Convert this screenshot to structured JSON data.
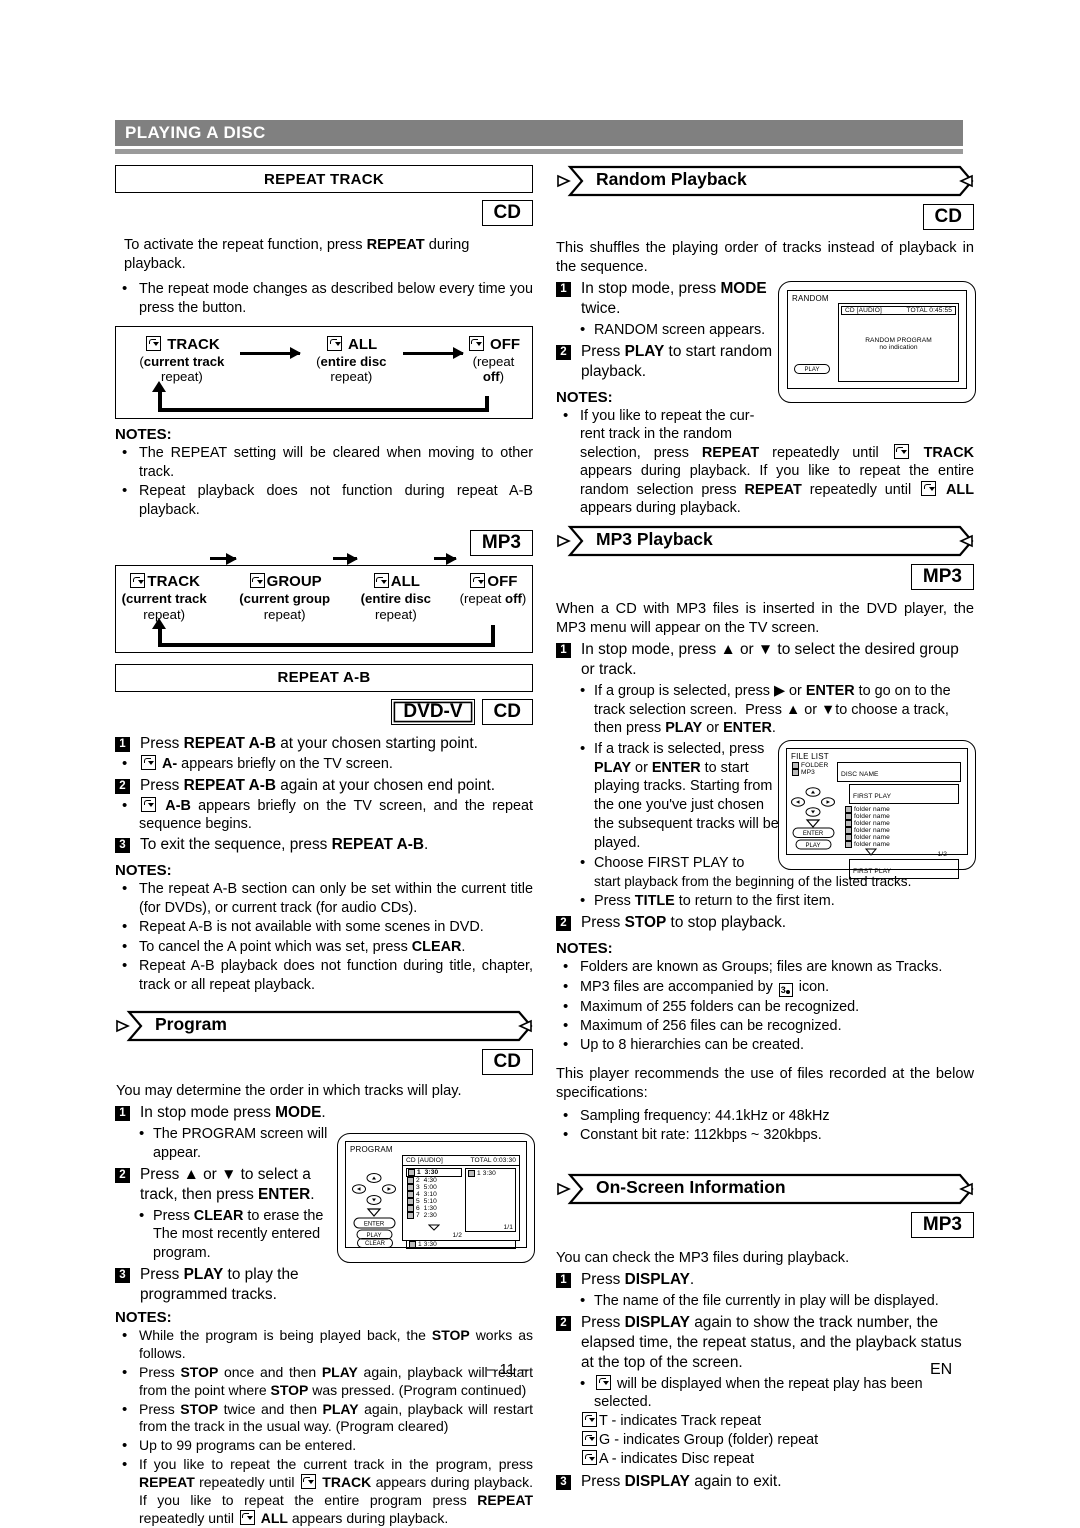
{
  "chapter": {
    "title": "PLAYING A DISC"
  },
  "footer": {
    "page": "– 11 –",
    "lang": "EN"
  },
  "left": {
    "repeat_track": {
      "box_title": "REPEAT TRACK",
      "badges": [
        "CD"
      ],
      "intro": "To activate the repeat function, press REPEAT during playback.",
      "intro_bold": "REPEAT",
      "bullets": [
        "The repeat mode changes as described below every time you press the button."
      ],
      "cd_flow": {
        "nodes": [
          {
            "title": "TRACK",
            "sub": "(current track repeat)",
            "sub_bold": "current track"
          },
          {
            "title": "ALL",
            "sub": "(entire disc repeat)",
            "sub_bold": "entire disc"
          },
          {
            "title": "OFF",
            "sub": "(repeat off)",
            "sub_bold": "off"
          }
        ]
      },
      "notes_label": "NOTES:",
      "notes": [
        "The REPEAT setting will be cleared when moving to other track.",
        "Repeat playback does not function during repeat A-B playback."
      ],
      "mp3_badge": "MP3",
      "mp3_flow": {
        "nodes": [
          {
            "title": "TRACK",
            "sub1": "(current track",
            "sub2": "repeat)"
          },
          {
            "title": "GROUP",
            "sub1": "(current group",
            "sub2": "repeat)"
          },
          {
            "title": "ALL",
            "sub1": "(entire disc",
            "sub2": "repeat)"
          },
          {
            "title": "OFF",
            "sub1": "(repeat off)",
            "sub2": ""
          }
        ]
      }
    },
    "repeat_ab": {
      "box_title": "REPEAT A-B",
      "badges": [
        "DVD-V",
        "CD"
      ],
      "steps": [
        {
          "n": "1",
          "text": "Press REPEAT A-B at your chosen starting point."
        },
        {
          "n": "2",
          "text": "Press REPEAT A-B again at your chosen end point."
        },
        {
          "n": "3",
          "text": "To exit the sequence, press REPEAT A-B."
        }
      ],
      "bullet_a": "A- appears briefly on the TV screen.",
      "bullet_ab": "A-B appears briefly on the TV screen, and the repeat sequence begins.",
      "notes_label": "NOTES:",
      "notes": [
        "The repeat A-B section can only be set within the current title (for DVDs), or current track (for audio CDs).",
        "Repeat A-B is not available with some scenes in DVD.",
        "To cancel the A point which was set, press CLEAR.",
        "Repeat A-B playback does not function during title, chapter, track or all repeat playback."
      ]
    },
    "program": {
      "heading": "Program",
      "badges": [
        "CD"
      ],
      "intro": "You may determine the order in which tracks will play.",
      "step1": "In stop mode press MODE.",
      "step1_bullet": "The PROGRAM screen will appear.",
      "step2": "Press ▲ or ▼ to select a track, then press ENTER.",
      "step2_bullet": "Press CLEAR to erase the The most recently entered program.",
      "step3": "Press PLAY to play the programmed tracks.",
      "notes_label": "NOTES:",
      "notes": [
        "While the program is being played back, the STOP works as follows.",
        "Press STOP once and then PLAY again, playback will restart from the point where STOP was pressed. (Program continued)",
        "Press STOP twice and then PLAY again, playback will restart from the track in the usual way. (Program cleared)",
        "Up to 99 programs can be entered.",
        "If you like to repeat the current track in the program, press REPEAT repeatedly until TRACK appears during playback. If you like to repeat the entire program press REPEAT repeatedly until ALL appears during playback."
      ],
      "screen": {
        "caption": "PROGRAM",
        "header_left": "CD [AUDIO]",
        "header_right": "TOTAL 0:03:30",
        "tracks": [
          {
            "no": "1",
            "time": "3:30"
          },
          {
            "no": "2",
            "time": "4:30"
          },
          {
            "no": "3",
            "time": "5:00"
          },
          {
            "no": "4",
            "time": "3:10"
          },
          {
            "no": "5",
            "time": "5:10"
          },
          {
            "no": "6",
            "time": "1:30"
          },
          {
            "no": "7",
            "time": "2:30"
          }
        ],
        "page_left": "1/2",
        "page_right": "1/1",
        "program_entry": "1   3:30",
        "bottom_entry": "1   3:30",
        "buttons": [
          "ENTER",
          "PLAY",
          "CLEAR"
        ]
      }
    }
  },
  "right": {
    "random": {
      "heading": "Random Playback",
      "badges": [
        "CD"
      ],
      "intro": "This shuffles the playing order of tracks instead of playback in the sequence.",
      "step1": "In stop mode, press MODE twice.",
      "step1_bullet": "RANDOM screen appears.",
      "step2": "Press PLAY to start random playback.",
      "notes_label": "NOTES:",
      "note1": "If you like to repeat the current track in the random selection, press REPEAT repeatedly until TRACK appears during playback. If you like to repeat the entire random selection press REPEAT repeatedly until ALL appears during playback.",
      "screen": {
        "caption": "RANDOM",
        "header_left": "CD [AUDIO]",
        "header_right": "TOTAL   0:45:55",
        "body_line1": "RANDOM PROGRAM",
        "body_line2": "no indication",
        "button": "PLAY"
      }
    },
    "mp3_playback": {
      "heading": "MP3 Playback",
      "badges": [
        "MP3"
      ],
      "intro": "When a CD with MP3 files is inserted in the DVD player, the MP3 menu will appear on the TV screen.",
      "step1": "In stop mode, press ▲ or ▼ to select the desired group or track.",
      "bullets": [
        "If a group is selected, press ▶ or ENTER to go on to the track selection screen.  Press ▲ or ▼to choose a track, then press PLAY or ENTER.",
        "If a track is selected, press PLAY or ENTER to start playing tracks. Starting from the one you've just chosen the subsequent tracks will be played.",
        "Choose FIRST PLAY to start playback from the beginning of the listed tracks.",
        "Press TITLE to return to the first item."
      ],
      "step2": "Press STOP to stop playback.",
      "notes_label": "NOTES:",
      "notes": [
        "Folders are known as Groups; files are known as Tracks.",
        "MP3 files are accompanied by  icon.",
        "Maximum of 255 folders can be recognized.",
        "Maximum of 256 files can be recognized.",
        "Up to 8 hierarchies can be created."
      ],
      "spec_intro": "This player recommends the use of files recorded at the below specifications:",
      "specs": [
        "Sampling frequency: 44.1kHz or 48kHz",
        "Constant bit rate: 112kbps ~ 320kbps."
      ],
      "screen": {
        "caption": "FILE LIST",
        "legend": [
          "FOLDER",
          "MP3"
        ],
        "disc_name": "DISC NAME",
        "first_play_top": "FIRST PLAY",
        "folders": [
          "folder name",
          "folder name",
          "folder name",
          "folder name",
          "folder name",
          "folder name"
        ],
        "page": "1/2",
        "first_play_bottom": "FIRST PLAY",
        "buttons": [
          "ENTER",
          "PLAY"
        ]
      }
    },
    "onscreen": {
      "heading": "On-Screen Information",
      "badges": [
        "MP3"
      ],
      "intro": "You can check the MP3 files during playback.",
      "step1": "Press DISPLAY.",
      "step1_bullet": "The name of the file currently in play will be displayed.",
      "step2": "Press DISPLAY again to show the track number, the elapsed time, the repeat status, and the playback status at the top of the screen.",
      "step2_bullet": "will be displayed when the repeat play has been selected.",
      "indicators": [
        "T - indicates Track repeat",
        "G - indicates Group (folder) repeat",
        "A - indicates Disc repeat"
      ],
      "step3": "Press DISPLAY again to exit."
    }
  }
}
